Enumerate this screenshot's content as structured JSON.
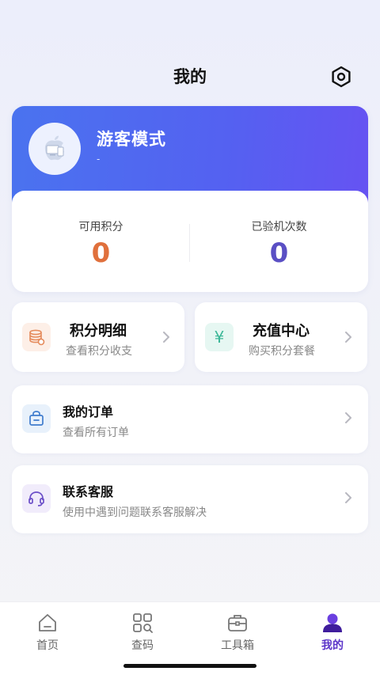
{
  "header": {
    "title": "我的"
  },
  "profile": {
    "name": "游客模式",
    "sub": "-"
  },
  "stats": [
    {
      "label": "可用积分",
      "value": "0",
      "color": "#e0703c"
    },
    {
      "label": "已验机次数",
      "value": "0",
      "color": "#5a4fc4"
    }
  ],
  "quick_cards": {
    "points": {
      "title": "积分明细",
      "sub": "查看积分收支"
    },
    "recharge": {
      "title": "充值中心",
      "sub": "购买积分套餐"
    }
  },
  "rows": {
    "orders": {
      "title": "我的订单",
      "sub": "查看所有订单"
    },
    "support": {
      "title": "联系客服",
      "sub": "使用中遇到问题联系客服解决"
    }
  },
  "tabs": [
    {
      "label": "首页",
      "icon": "home-icon"
    },
    {
      "label": "查码",
      "icon": "grid-search-icon"
    },
    {
      "label": "工具箱",
      "icon": "toolbox-icon"
    },
    {
      "label": "我的",
      "icon": "profile-icon",
      "active": true
    }
  ],
  "colors": {
    "accent": "#5b35c9",
    "banner": "#4f68f0"
  }
}
